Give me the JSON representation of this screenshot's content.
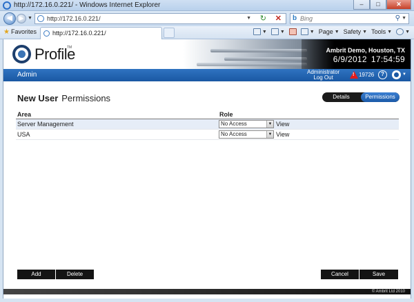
{
  "window": {
    "title": "http://172.16.0.221/ - Windows Internet Explorer",
    "minimize": "‒",
    "maximize": "□",
    "close": "✕"
  },
  "address": {
    "url": "http://172.16.0.221/",
    "search_placeholder": "Bing"
  },
  "favorites_bar": {
    "favorites_label": "Favorites",
    "tab_title": "http://172.16.0.221/",
    "page_menu": "Page",
    "safety_menu": "Safety",
    "tools_menu": "Tools"
  },
  "header": {
    "logo_text": "Profile",
    "logo_tm": "TM",
    "site_name": "Ambrit Demo, Houston, TX",
    "date": "6/9/2012",
    "time": "17:54:59"
  },
  "navbar": {
    "section": "Admin",
    "user_name": "Administrator",
    "logout": "Log Out",
    "alert_count": "19726",
    "help": "?"
  },
  "page": {
    "title": "New User",
    "subtitle": "Permissions",
    "tabs": {
      "details": "Details",
      "permissions": "Permissions"
    }
  },
  "table": {
    "columns": [
      "Area",
      "Role"
    ],
    "rows": [
      {
        "area": "Server Management",
        "role": "No Access",
        "action": "View"
      },
      {
        "area": "USA",
        "role": "No Access",
        "action": "View"
      }
    ]
  },
  "buttons": {
    "add": "Add",
    "delete": "Delete",
    "cancel": "Cancel",
    "save": "Save"
  },
  "footer": {
    "copyright": "© Ambrit Ltd 2010"
  },
  "colors": {
    "nav_blue": "#1a58a3",
    "button_black": "#141414",
    "alert_red": "#e21b1b",
    "row_highlight": "#e6edf7"
  }
}
